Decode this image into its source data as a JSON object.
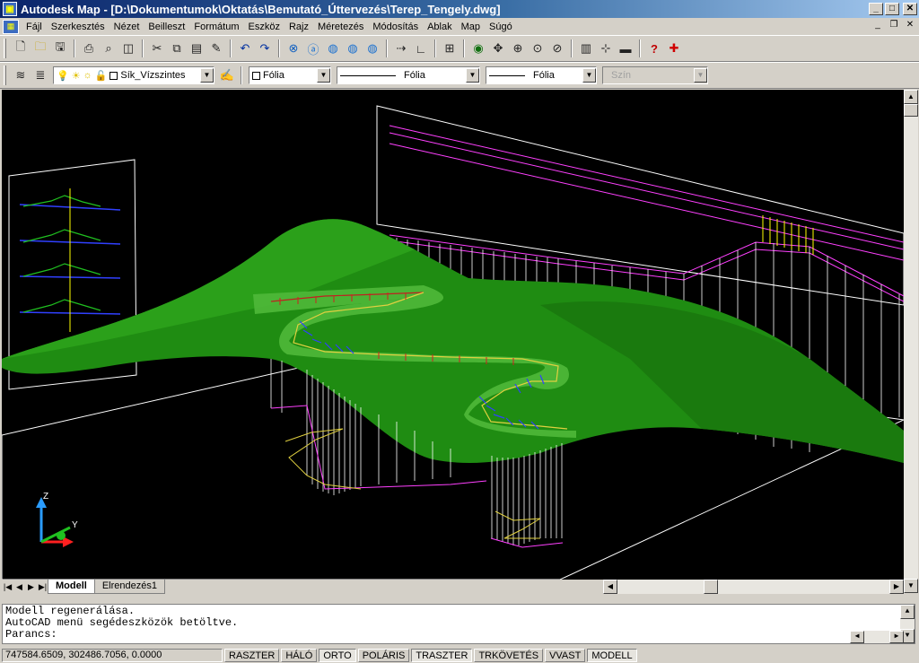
{
  "window": {
    "title": "Autodesk Map - [D:\\Dokumentumok\\Oktatás\\Bemutató_Úttervezés\\Terep_Tengely.dwg]",
    "icon": "autocad-app-icon",
    "buttons": [
      "minimize",
      "maximize",
      "close"
    ]
  },
  "menubar": {
    "items": [
      "Fájl",
      "Szerkesztés",
      "Nézet",
      "Beilleszt",
      "Formátum",
      "Eszköz",
      "Rajz",
      "Méretezés",
      "Módosítás",
      "Ablak",
      "Map",
      "Súgó"
    ]
  },
  "toolbar1": {
    "icons": [
      "new-icon",
      "open-icon",
      "save-icon",
      "print-icon",
      "print-preview-icon",
      "publish-icon",
      "cut-icon",
      "copy-icon",
      "paste-icon",
      "match-properties-icon",
      "undo-icon",
      "redo-icon",
      "hyperlink-icon",
      "publish-web-icon",
      "globe-icon",
      "globe-2-icon",
      "globe-3-icon",
      "snap-icon",
      "ucs-icon",
      "viewport-icon",
      "pan-icon",
      "3d-orbit-icon",
      "zoom-realtime-icon",
      "zoom-window-icon",
      "zoom-previous-icon",
      "properties-icon",
      "design-center-icon",
      "tool-palette-icon",
      "help-icon",
      "map-add-icon"
    ]
  },
  "toolbar2": {
    "layer_icons": [
      "layer-manager-icon",
      "layer-previous-icon",
      "lightbulb-icon",
      "sun-icon",
      "sun-viewport-icon",
      "lock-icon"
    ],
    "layer_value": "Sík_Vízszintes",
    "make_current_icon": "make-layer-current-icon",
    "color_value": "Fólia",
    "linetype_value": "Fólia",
    "lineweight_value": "Fólia",
    "plotstyle_value": "Szín"
  },
  "drawing": {
    "background": "#000000",
    "terrain_color": "#1f8c12",
    "ucs_labels": {
      "z": "Z",
      "y": "Y"
    }
  },
  "tabs": {
    "items": [
      "Modell",
      "Elrendezés1"
    ],
    "active": "Modell"
  },
  "command": {
    "lines": [
      "Modell regenerálása.",
      "AutoCAD menü segédeszközök betöltve.",
      "Parancs:"
    ]
  },
  "status": {
    "coords": "747584.6509, 302486.7056, 0.0000",
    "toggles": [
      {
        "label": "RASZTER",
        "on": false
      },
      {
        "label": "HÁLÓ",
        "on": false
      },
      {
        "label": "ORTO",
        "on": true
      },
      {
        "label": "POLÁRIS",
        "on": false
      },
      {
        "label": "TRASZTER",
        "on": true
      },
      {
        "label": "TRKÖVETÉS",
        "on": false
      },
      {
        "label": "VVAST",
        "on": false
      },
      {
        "label": "MODELL",
        "on": true
      }
    ]
  }
}
